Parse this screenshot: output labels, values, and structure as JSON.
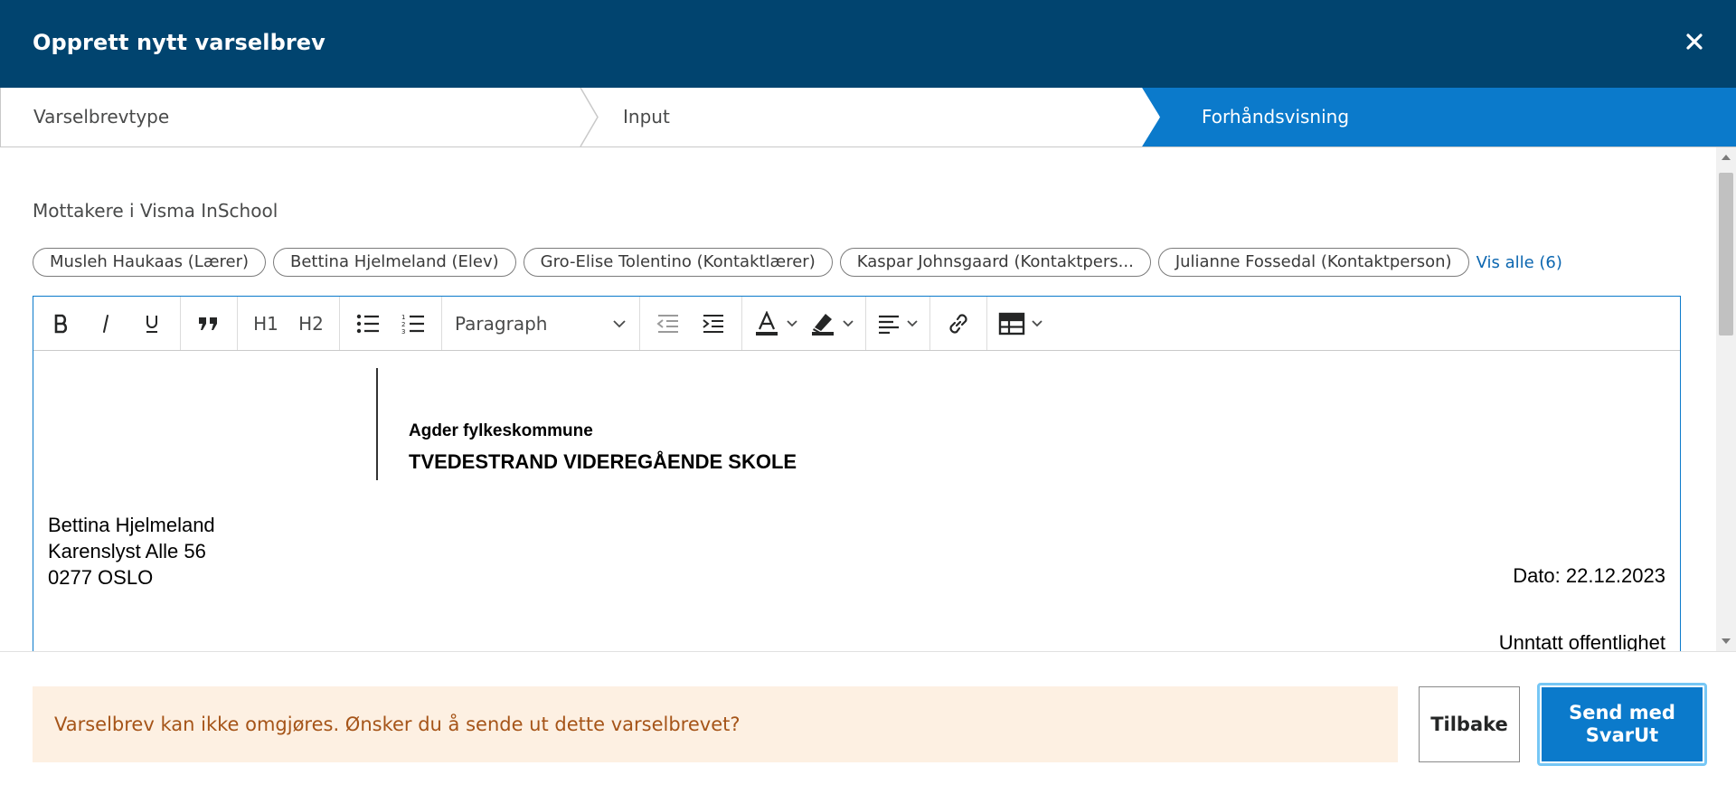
{
  "dialog": {
    "title": "Opprett nytt varselbrev",
    "close_icon": "close-icon"
  },
  "stepper": {
    "steps": [
      {
        "label": "Varselbrevtype",
        "active": false
      },
      {
        "label": "Input",
        "active": false
      },
      {
        "label": "Forhåndsvisning",
        "active": true
      }
    ]
  },
  "recipients": {
    "label": "Mottakere i Visma InSchool",
    "chips": [
      "Musleh Haukaas (Lærer)",
      "Bettina Hjelmeland (Elev)",
      "Gro-Elise Tolentino (Kontaktlærer)",
      "Kaspar Johnsgaard (Kontaktpers...",
      "Julianne Fossedal (Kontaktperson)"
    ],
    "show_all": "Vis alle (6)"
  },
  "toolbar": {
    "h1": "H1",
    "h2": "H2",
    "paragraph_select": "Paragraph"
  },
  "document": {
    "org_line1": "Agder fylkeskommune",
    "org_line2": "TVEDESTRAND VIDEREGÅENDE SKOLE",
    "address": [
      "Bettina Hjelmeland",
      "Karenslyst Alle 56",
      "0277 OSLO"
    ],
    "date": "Dato: 22.12.2023",
    "classification": "Unntatt offentlighet"
  },
  "footer": {
    "warning": "Varselbrev kan ikke omgjøres. Ønsker du å sende ut dette varselbrevet?",
    "back_label": "Tilbake",
    "send_label_line1": "Send med",
    "send_label_line2": "SvarUt"
  },
  "colors": {
    "header_bg": "#01446f",
    "accent": "#0b7acb",
    "warning_bg": "#fdf0e2",
    "warning_text": "#a55418"
  }
}
